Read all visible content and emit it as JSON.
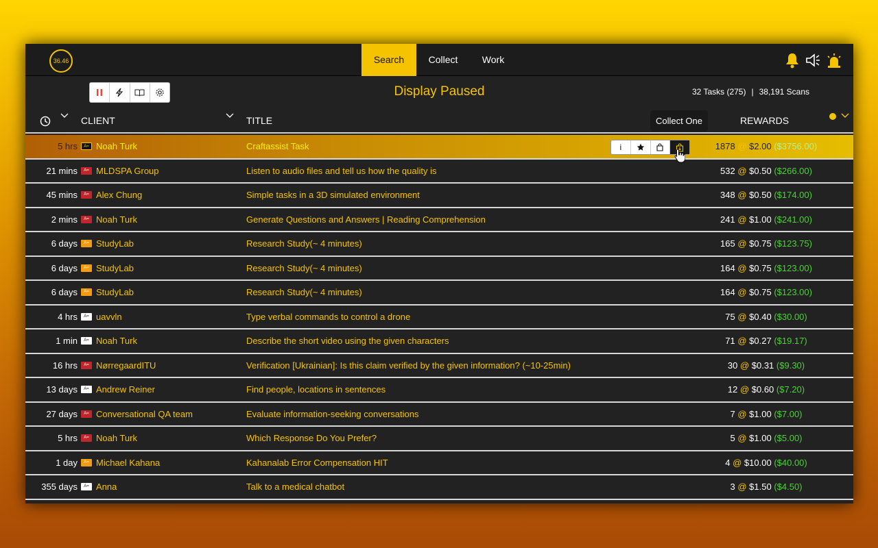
{
  "timer": "36.46",
  "nav": {
    "tabs": [
      "Search",
      "Collect",
      "Work"
    ],
    "active": "Search"
  },
  "toolbar": {
    "buttons": [
      "pause-icon",
      "bolt-icon",
      "book-icon",
      "gear-icon"
    ]
  },
  "status": "Display Paused",
  "counts": {
    "tasks": "32 Tasks (275)",
    "scans": "38,191 Scans"
  },
  "columns": {
    "client": "CLIENT",
    "title": "TITLE",
    "rewards": "REWARDS"
  },
  "tooltip": "Collect One",
  "colors": {
    "accent": "#f5c300",
    "total": "#4cd137",
    "badge_red": "#c0272d",
    "badge_orange": "#f39c12",
    "badge_white": "#ffffff"
  },
  "rows": [
    {
      "time": "5 hrs",
      "badge": "black",
      "client": "Noah Turk",
      "title": "Craftassist Task",
      "count": "1878",
      "price": "$2.00",
      "total": "($3756.00)"
    },
    {
      "time": "21 mins",
      "badge": "red",
      "client": "MLDSPA Group",
      "title": "Listen to audio files and tell us how the quality is",
      "count": "532",
      "price": "$0.50",
      "total": "($266.00)"
    },
    {
      "time": "45 mins",
      "badge": "red",
      "client": "Alex Chung",
      "title": "Simple tasks in a 3D simulated environment",
      "count": "348",
      "price": "$0.50",
      "total": "($174.00)"
    },
    {
      "time": "2 mins",
      "badge": "red",
      "client": "Noah Turk",
      "title": "Generate Questions and Answers | Reading Comprehension",
      "count": "241",
      "price": "$1.00",
      "total": "($241.00)"
    },
    {
      "time": "6 days",
      "badge": "orange",
      "client": "StudyLab",
      "title": "Research Study(~ 4 minutes)",
      "count": "165",
      "price": "$0.75",
      "total": "($123.75)"
    },
    {
      "time": "6 days",
      "badge": "orange",
      "client": "StudyLab",
      "title": "Research Study(~ 4 minutes)",
      "count": "164",
      "price": "$0.75",
      "total": "($123.00)"
    },
    {
      "time": "6 days",
      "badge": "orange",
      "client": "StudyLab",
      "title": "Research Study(~ 4 minutes)",
      "count": "164",
      "price": "$0.75",
      "total": "($123.00)"
    },
    {
      "time": "4 hrs",
      "badge": "white",
      "client": "uavvln",
      "title": "Type verbal commands to control a drone",
      "count": "75",
      "price": "$0.40",
      "total": "($30.00)"
    },
    {
      "time": "1 min",
      "badge": "white",
      "client": "Noah Turk",
      "title": "Describe the short video using the given characters",
      "count": "71",
      "price": "$0.27",
      "total": "($19.17)"
    },
    {
      "time": "16 hrs",
      "badge": "red",
      "client": "NørregaardITU",
      "title": "Verification [Ukrainian]: Is this claim verified by the given information? (~10-25min)",
      "count": "30",
      "price": "$0.31",
      "total": "($9.30)"
    },
    {
      "time": "13 days",
      "badge": "white",
      "client": "Andrew Reiner",
      "title": "Find people, locations in sentences",
      "count": "12",
      "price": "$0.60",
      "total": "($7.20)"
    },
    {
      "time": "27 days",
      "badge": "red",
      "client": "Conversational QA team",
      "title": "Evaluate information-seeking conversations",
      "count": "7",
      "price": "$1.00",
      "total": "($7.00)"
    },
    {
      "time": "5 hrs",
      "badge": "red",
      "client": "Noah Turk",
      "title": "Which Response Do You Prefer?",
      "count": "5",
      "price": "$1.00",
      "total": "($5.00)"
    },
    {
      "time": "1 day",
      "badge": "orange",
      "client": "Michael Kahana",
      "title": "Kahanalab Error Compensation HIT",
      "count": "4",
      "price": "$10.00",
      "total": "($40.00)"
    },
    {
      "time": "355 days",
      "badge": "white",
      "client": "Anna",
      "title": "Talk to a medical chatbot",
      "count": "3",
      "price": "$1.50",
      "total": "($4.50)"
    }
  ]
}
